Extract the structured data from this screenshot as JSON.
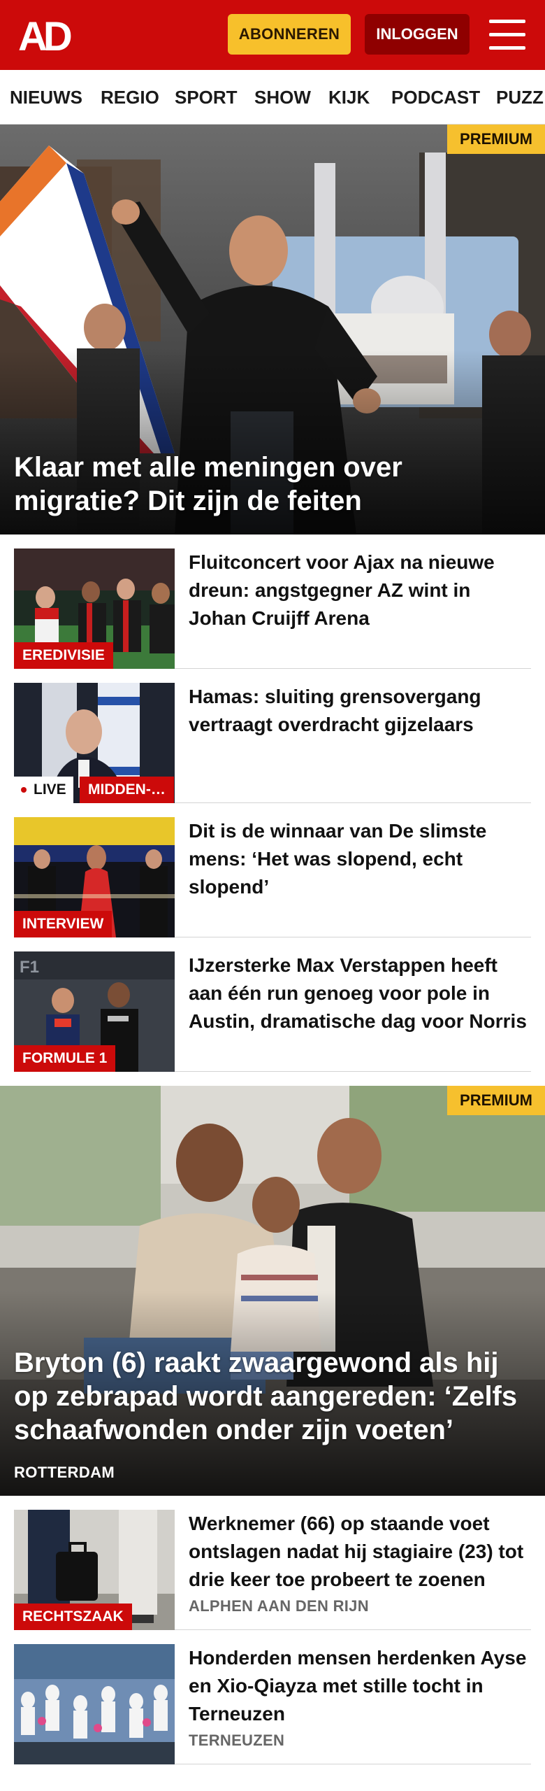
{
  "header": {
    "logo_text": "AD",
    "subscribe_label": "ABONNEREN",
    "login_label": "INLOGGEN",
    "menu_icon": "hamburger-menu-icon",
    "colors": {
      "brand_red": "#cc0a0a",
      "subscribe_yellow": "#f7c02b",
      "login_dark_red": "#8f0000"
    }
  },
  "nav": {
    "items": [
      "NIEUWS",
      "REGIO",
      "SPORT",
      "SHOW",
      "KIJK",
      "PODCAST",
      "PUZZ"
    ]
  },
  "hero1": {
    "badge": "PREMIUM",
    "title": "Klaar met alle meningen over migratie? Dit zijn de feiten"
  },
  "articles1": [
    {
      "tag": "EREDIVISIE",
      "title": "Fluitconcert voor Ajax na nieuwe dreun: angstgegner AZ wint in Johan Cruijff Arena"
    },
    {
      "live": "LIVE",
      "tag": "MIDDEN-…",
      "title": "Hamas: sluiting grensovergang vertraagt overdracht gijzelaars"
    },
    {
      "tag": "INTERVIEW",
      "title": "Dit is de winnaar van De slimste mens: ‘Het was slopend, echt slopend’"
    },
    {
      "tag": "FORMULE 1",
      "title": "IJzersterke Max Verstappen heeft aan één run genoeg voor pole in Austin, dramatische dag voor Norris"
    }
  ],
  "hero2": {
    "badge": "PREMIUM",
    "title": "Bryton (6) raakt zwaargewond als hij op zebrapad wordt aangereden: ‘Zelfs schaafwonden onder zijn voeten’",
    "location": "ROTTERDAM"
  },
  "articles2": [
    {
      "tag": "RECHTSZAAK",
      "title": "Werknemer (66) op staande voet ontslagen nadat hij stagiaire (23) tot drie keer toe probeert te zoenen",
      "location": "ALPHEN AAN DEN RIJN"
    },
    {
      "title": "Honderden mensen herdenken Ayse en Xio-Qiayza met stille tocht in Terneuzen",
      "location": "TERNEUZEN"
    }
  ]
}
